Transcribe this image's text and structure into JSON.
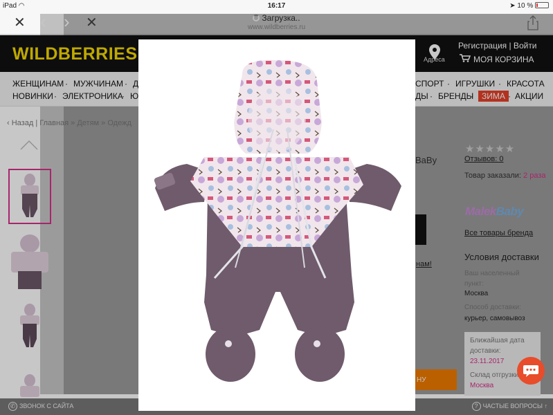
{
  "status": {
    "device": "iPad",
    "time": "16:17",
    "battery": "10 %"
  },
  "browser": {
    "title": "Загрузка..",
    "url": "www.wildberries.ru",
    "close": "✕",
    "back": "‹",
    "forward": "›",
    "stop": "✕",
    "share": "⇧"
  },
  "header": {
    "logo": "WILDBERRIES",
    "location_label": "Адреса",
    "account": "Регистрация | Войти",
    "cart": "МОЯ КОРЗИНА"
  },
  "nav": {
    "row1": [
      "ЖЕНЩИНАМ",
      "МУЖЧИНАМ",
      "Д",
      "СПОРТ",
      "ИГРУШКИ",
      "КРАСОТА"
    ],
    "row2": [
      "НОВИНКИ",
      "ЭЛЕКТРОНИКА",
      "Ю",
      "ДЫ",
      "БРЕНДЫ",
      "ЗИМА",
      "АКЦИИ"
    ]
  },
  "breadcrumb": {
    "back": "Назад",
    "home": "Главная",
    "kids": "Детям",
    "partial": "Одежд"
  },
  "product": {
    "title_fragment": "BaBy",
    "link_fragment": "нам!",
    "orange_button_fragment": "НУ"
  },
  "sidebar": {
    "reviews": "Отзывов: 0",
    "ordered_prefix": "Товар заказали:",
    "ordered_value": "2 раза",
    "brand_logo_a": "Malek",
    "brand_logo_b": "Baby",
    "brand_all": "Все товары бренда",
    "delivery_title": "Условия доставки",
    "locality_label": "Ваш населенный пункт:",
    "locality_value": "Москва",
    "method_label": "Способ доставки:",
    "method_value": "курьер, самовывоз",
    "nearest_label": "Ближайшая дата доставки:",
    "nearest_value": "23.11.2017",
    "warehouse_label": "Склад отгрузки:",
    "warehouse_value": "Москва"
  },
  "bottom": {
    "call": "ЗВОНОК С САЙТА",
    "faq": "ЧАСТЫЕ ВОПРОСЫ"
  },
  "colors": {
    "brand_yellow": "#f5d800",
    "accent_pink": "#d63089",
    "winter_red": "#e4402a",
    "chat_orange": "#e84c2b"
  },
  "icons": {
    "location": "location-pin-icon",
    "cart": "cart-icon",
    "chat": "chat-bubble-icon",
    "phone": "phone-icon",
    "help": "question-circle-icon"
  }
}
